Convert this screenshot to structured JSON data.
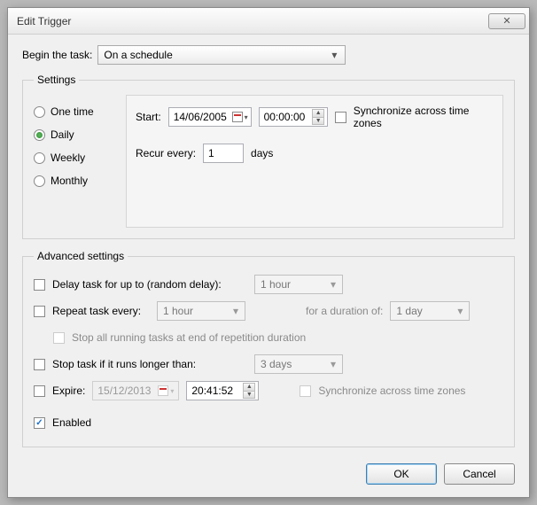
{
  "title": "Edit Trigger",
  "begin_label": "Begin the task:",
  "begin_value": "On a schedule",
  "settings_legend": "Settings",
  "radios": {
    "one_time": "One time",
    "daily": "Daily",
    "weekly": "Weekly",
    "monthly": "Monthly"
  },
  "start_label": "Start:",
  "start_date": "14/06/2005",
  "start_time": "00:00:00",
  "sync_label": "Synchronize across time zones",
  "recur_label": "Recur every:",
  "recur_value": "1",
  "recur_unit": "days",
  "adv_legend": "Advanced settings",
  "delay_label": "Delay task for up to (random delay):",
  "delay_value": "1 hour",
  "repeat_label": "Repeat task every:",
  "repeat_value": "1 hour",
  "duration_label": "for a duration of:",
  "duration_value": "1 day",
  "stop_all_label": "Stop all running tasks at end of repetition duration",
  "stop_if_label": "Stop task if it runs longer than:",
  "stop_if_value": "3 days",
  "expire_label": "Expire:",
  "expire_date": "15/12/2013",
  "expire_time": "20:41:52",
  "sync2_label": "Synchronize across time zones",
  "enabled_label": "Enabled",
  "ok_label": "OK",
  "cancel_label": "Cancel"
}
